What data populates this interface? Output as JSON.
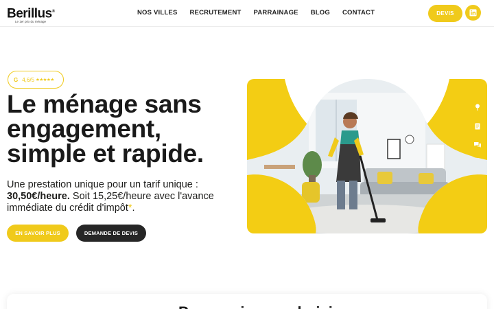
{
  "brand": {
    "name": "Berillus",
    "registered": "®",
    "tagline": "Le 1er prix du ménage"
  },
  "nav": {
    "items": [
      "NOS VILLES",
      "RECRUTEMENT",
      "PARRAINAGE",
      "BLOG",
      "CONTACT"
    ],
    "devis_label": "DEVIS"
  },
  "hero": {
    "rating_g": "G",
    "rating_value": "4,6/5",
    "rating_stars": "★★★★★",
    "headline": "Le ménage sans engagement, simple et rapide.",
    "desc_intro": "Une prestation unique pour un tarif unique :",
    "desc_price": "30,50€/heure.",
    "desc_rest": " Soit 15,25€/heure avec l'avance immédiate du crédit d'impôt",
    "desc_asterisk": "*",
    "desc_end": ".",
    "btn_more": "EN SAVOIR PLUS",
    "btn_quote": "DEMANDE DE DEVIS"
  },
  "bottom": {
    "title": "Pourquoi nous choisir"
  },
  "colors": {
    "accent": "#f0ca1b",
    "dark": "#262626"
  },
  "icons": [
    "linkedin-icon",
    "location-pin-icon",
    "document-icon",
    "chat-icon"
  ]
}
